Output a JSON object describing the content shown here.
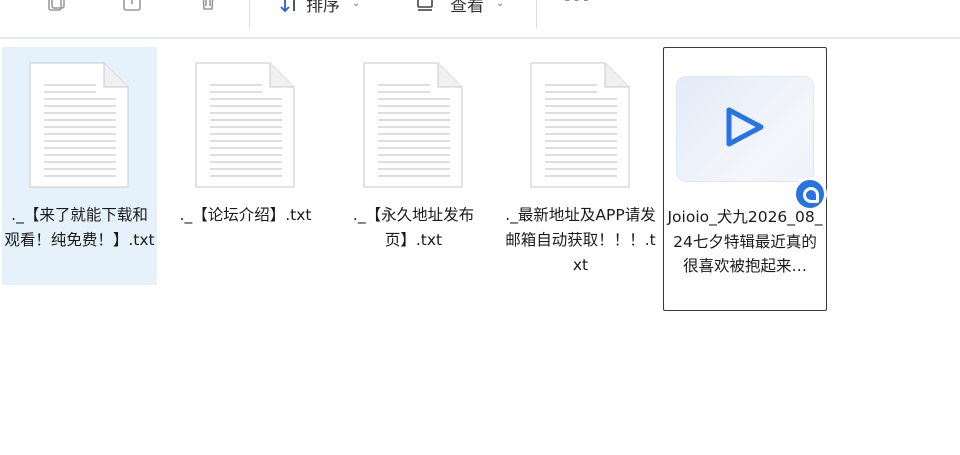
{
  "toolbar": {
    "sort_label": "排序",
    "view_label": "查看",
    "more_label": "···"
  },
  "files": [
    {
      "name": "._【来了就能下载和观看！纯免费！】.txt",
      "type": "txt",
      "selected": true
    },
    {
      "name": "._【论坛介绍】.txt",
      "type": "txt",
      "selected": false
    },
    {
      "name": "._【永久地址发布页】.txt",
      "type": "txt",
      "selected": false
    },
    {
      "name": "._最新地址及APP请发邮箱自动获取！！！.txt",
      "type": "txt",
      "selected": false
    },
    {
      "name": "Joioio_犬九2026_08_24七夕特辑最近真的很喜欢被抱起来…",
      "type": "video",
      "selected": false,
      "focused": true
    }
  ],
  "colors": {
    "selection": "#e5f1fb",
    "accent": "#2773e6"
  }
}
